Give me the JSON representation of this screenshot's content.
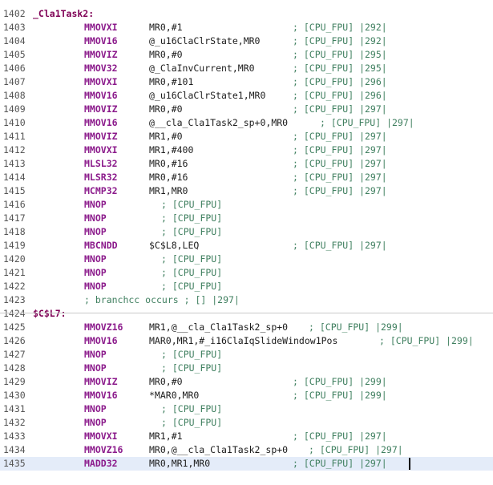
{
  "editor": {
    "lines": [
      {
        "num": "1402",
        "label": "_Cla1Task2:",
        "mnem": "",
        "ops": "",
        "cmt": ""
      },
      {
        "num": "1403",
        "label": "",
        "mnem": "MMOVXI",
        "ops": "MR0,#1",
        "cmt": "; [CPU_FPU] |292|"
      },
      {
        "num": "1404",
        "label": "",
        "mnem": "MMOV16",
        "ops": "@_u16ClaClrState,MR0",
        "cmt": "; [CPU_FPU] |292|"
      },
      {
        "num": "1405",
        "label": "",
        "mnem": "MMOVIZ",
        "ops": "MR0,#0",
        "cmt": "; [CPU_FPU] |295|"
      },
      {
        "num": "1406",
        "label": "",
        "mnem": "MMOV32",
        "ops": "@_ClaInvCurrent,MR0",
        "cmt": "; [CPU_FPU] |295|"
      },
      {
        "num": "1407",
        "label": "",
        "mnem": "MMOVXI",
        "ops": "MR0,#101",
        "cmt": "; [CPU_FPU] |296|"
      },
      {
        "num": "1408",
        "label": "",
        "mnem": "MMOV16",
        "ops": "@_u16ClaClrState1,MR0",
        "cmt": "; [CPU_FPU] |296|"
      },
      {
        "num": "1409",
        "label": "",
        "mnem": "MMOVIZ",
        "ops": "MR0,#0",
        "cmt": "; [CPU_FPU] |297|"
      },
      {
        "num": "1410",
        "label": "",
        "mnem": "MMOV16",
        "ops": "@__cla_Cla1Task2_sp+0,MR0",
        "cmt": "; [CPU_FPU] |297|"
      },
      {
        "num": "1411",
        "label": "",
        "mnem": "MMOVIZ",
        "ops": "MR1,#0",
        "cmt": "; [CPU_FPU] |297|"
      },
      {
        "num": "1412",
        "label": "",
        "mnem": "MMOVXI",
        "ops": "MR1,#400",
        "cmt": "; [CPU_FPU] |297|"
      },
      {
        "num": "1413",
        "label": "",
        "mnem": "MLSL32",
        "ops": "MR0,#16",
        "cmt": "; [CPU_FPU] |297|"
      },
      {
        "num": "1414",
        "label": "",
        "mnem": "MLSR32",
        "ops": "MR0,#16",
        "cmt": "; [CPU_FPU] |297|"
      },
      {
        "num": "1415",
        "label": "",
        "mnem": "MCMP32",
        "ops": "MR1,MR0",
        "cmt": "; [CPU_FPU] |297|"
      },
      {
        "num": "1416",
        "label": "",
        "mnem": "MNOP",
        "ops": "",
        "cmt": "; [CPU_FPU]"
      },
      {
        "num": "1417",
        "label": "",
        "mnem": "MNOP",
        "ops": "",
        "cmt": "; [CPU_FPU]"
      },
      {
        "num": "1418",
        "label": "",
        "mnem": "MNOP",
        "ops": "",
        "cmt": "; [CPU_FPU]"
      },
      {
        "num": "1419",
        "label": "",
        "mnem": "MBCNDD",
        "ops": "$C$L8,LEQ",
        "cmt": "; [CPU_FPU] |297|"
      },
      {
        "num": "1420",
        "label": "",
        "mnem": "MNOP",
        "ops": "",
        "cmt": "; [CPU_FPU]"
      },
      {
        "num": "1421",
        "label": "",
        "mnem": "MNOP",
        "ops": "",
        "cmt": "; [CPU_FPU]"
      },
      {
        "num": "1422",
        "label": "",
        "mnem": "MNOP",
        "ops": "",
        "cmt": "; [CPU_FPU]"
      },
      {
        "num": "1423",
        "label": "",
        "mnem": "",
        "ops": "",
        "cmt": "; branchcc occurs ; [] |297|"
      },
      {
        "num": "1424",
        "label": "$C$L7:",
        "mnem": "",
        "ops": "",
        "cmt": ""
      },
      {
        "num": "1425",
        "label": "",
        "mnem": "MMOVZ16",
        "ops": "MR1,@__cla_Cla1Task2_sp+0",
        "cmt": "; [CPU_FPU] |299|"
      },
      {
        "num": "1426",
        "label": "",
        "mnem": "MMOV16",
        "ops": "MAR0,MR1,#_i16ClaIqSlideWindow1Pos",
        "cmt": "; [CPU_FPU] |299|"
      },
      {
        "num": "1427",
        "label": "",
        "mnem": "MNOP",
        "ops": "",
        "cmt": "; [CPU_FPU]"
      },
      {
        "num": "1428",
        "label": "",
        "mnem": "MNOP",
        "ops": "",
        "cmt": "; [CPU_FPU]"
      },
      {
        "num": "1429",
        "label": "",
        "mnem": "MMOVIZ",
        "ops": "MR0,#0",
        "cmt": "; [CPU_FPU] |299|"
      },
      {
        "num": "1430",
        "label": "",
        "mnem": "MMOV16",
        "ops": "*MAR0,MR0",
        "cmt": "; [CPU_FPU] |299|"
      },
      {
        "num": "1431",
        "label": "",
        "mnem": "MNOP",
        "ops": "",
        "cmt": "; [CPU_FPU]"
      },
      {
        "num": "1432",
        "label": "",
        "mnem": "MNOP",
        "ops": "",
        "cmt": "; [CPU_FPU]"
      },
      {
        "num": "1433",
        "label": "",
        "mnem": "MMOVXI",
        "ops": "MR1,#1",
        "cmt": "; [CPU_FPU] |297|"
      },
      {
        "num": "1434",
        "label": "",
        "mnem": "MMOVZ16",
        "ops": "MR0,@__cla_Cla1Task2_sp+0",
        "cmt": "; [CPU_FPU] |297|"
      },
      {
        "num": "1435",
        "label": "",
        "mnem": "MADD32",
        "ops": "MR0,MR1,MR0",
        "cmt": "; [CPU_FPU] |297|"
      }
    ]
  }
}
